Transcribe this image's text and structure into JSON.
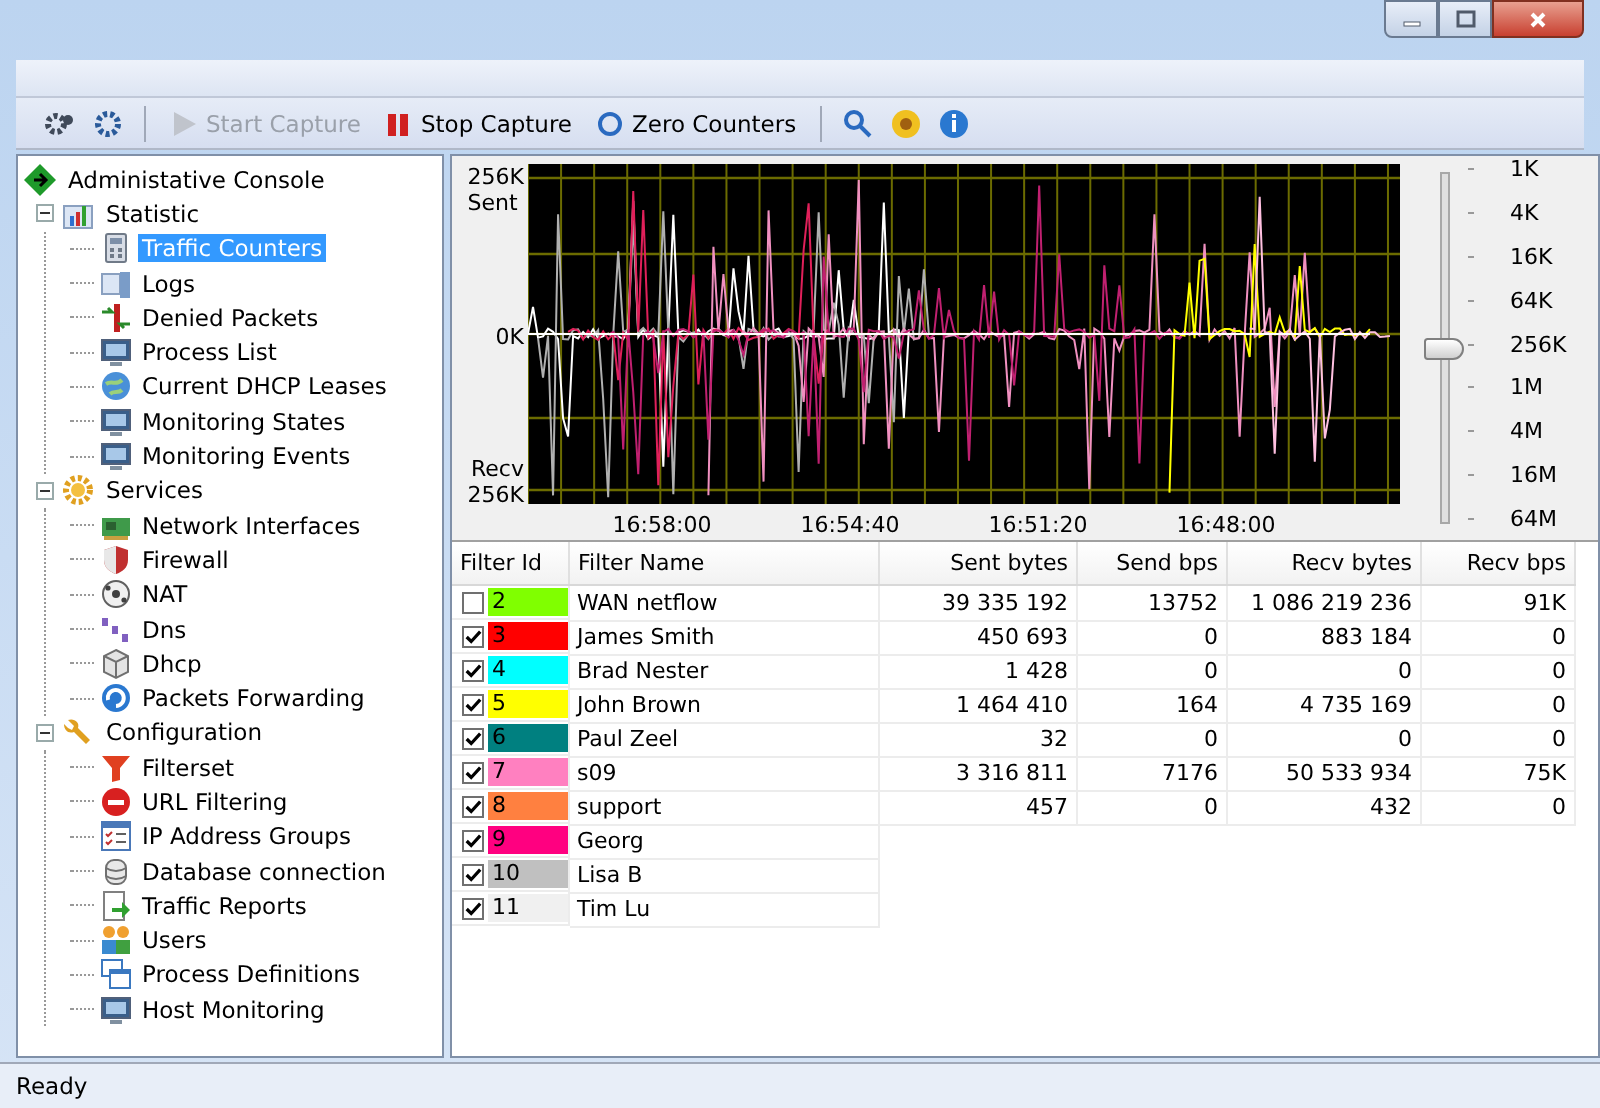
{
  "toolbar": {
    "buttons": [
      {
        "label": "Start Capture",
        "disabled": true
      },
      {
        "label": "Stop Capture",
        "disabled": false
      },
      {
        "label": "Zero Counters",
        "disabled": false
      }
    ]
  },
  "tree": {
    "label": "Administative Console",
    "children": [
      {
        "label": "Statistic",
        "expanded": true,
        "children": [
          {
            "label": "Traffic Counters",
            "selected": true
          },
          {
            "label": "Logs",
            "selected": false
          },
          {
            "label": "Denied Packets",
            "selected": false
          },
          {
            "label": "Process List",
            "selected": false
          },
          {
            "label": "Current DHCP Leases",
            "selected": false
          },
          {
            "label": "Monitoring States",
            "selected": false
          },
          {
            "label": "Monitoring Events",
            "selected": false
          }
        ]
      },
      {
        "label": "Services",
        "expanded": true,
        "children": [
          {
            "label": "Network Interfaces",
            "selected": false
          },
          {
            "label": "Firewall",
            "selected": false
          },
          {
            "label": "NAT",
            "selected": false
          },
          {
            "label": "Dns",
            "selected": false
          },
          {
            "label": "Dhcp",
            "selected": false
          },
          {
            "label": "Packets Forwarding",
            "selected": false
          }
        ]
      },
      {
        "label": "Configuration",
        "expanded": true,
        "children": [
          {
            "label": "Filterset",
            "selected": false
          },
          {
            "label": "URL Filtering",
            "selected": false
          },
          {
            "label": "IP Address Groups",
            "selected": false
          },
          {
            "label": "Database connection",
            "selected": false
          },
          {
            "label": "Traffic Reports",
            "selected": false
          },
          {
            "label": "Users",
            "selected": false
          },
          {
            "label": "Process Definitions",
            "selected": false
          },
          {
            "label": "Host Monitoring",
            "selected": false
          }
        ]
      }
    ]
  },
  "graph": {
    "sent_value": "256K",
    "sent_caption": "Sent",
    "zero_value": "0K",
    "recv_caption": "Recv",
    "recv_value": "256K",
    "time_labels": [
      "16:58:00",
      "16:54:40",
      "16:51:20",
      "16:48:00"
    ]
  },
  "zoom_slider": {
    "level": 0.5,
    "scale_labels": [
      "1K",
      "4K",
      "16K",
      "64K",
      "256K",
      "1M",
      "4M",
      "16M",
      "64M"
    ]
  },
  "table": {
    "columns": [
      "Filter Id",
      "Filter Name",
      "Sent bytes",
      "Send bps",
      "Recv bytes",
      "Recv bps"
    ],
    "rows": [
      {
        "checked": false,
        "color": "#80ff00",
        "id": "2",
        "name": "WAN netflow",
        "sent": "39 335 192",
        "send_bps": "13752",
        "recv": "1 086 219 236",
        "recv_bps": "91K"
      },
      {
        "checked": true,
        "color": "#ff0000",
        "id": "3",
        "name": "James Smith",
        "sent": "450 693",
        "send_bps": "0",
        "recv": "883 184",
        "recv_bps": "0"
      },
      {
        "checked": true,
        "color": "#00ffff",
        "id": "4",
        "name": "Brad Nester",
        "sent": "1 428",
        "send_bps": "0",
        "recv": "0",
        "recv_bps": "0"
      },
      {
        "checked": true,
        "color": "#ffff00",
        "id": "5",
        "name": "John Brown",
        "sent": "1 464 410",
        "send_bps": "164",
        "recv": "4 735 169",
        "recv_bps": "0"
      },
      {
        "checked": true,
        "color": "#008080",
        "id": "6",
        "name": "Paul Zeel",
        "sent": "32",
        "send_bps": "0",
        "recv": "0",
        "recv_bps": "0"
      },
      {
        "checked": true,
        "color": "#ff80c0",
        "id": "7",
        "name": "s09",
        "sent": "3 316 811",
        "send_bps": "7176",
        "recv": "50 533 934",
        "recv_bps": "75K"
      },
      {
        "checked": true,
        "color": "#ff8040",
        "id": "8",
        "name": "support",
        "sent": "457",
        "send_bps": "0",
        "recv": "432",
        "recv_bps": "0"
      },
      {
        "checked": true,
        "color": "#ff0080",
        "id": "9",
        "name": "Georg"
      },
      {
        "checked": true,
        "color": "#c0c0c0",
        "id": "10",
        "name": "Lisa B"
      },
      {
        "checked": true,
        "color": "#f0f0f0",
        "id": "11",
        "name": "Tim Lu"
      }
    ]
  },
  "status_bar": "Ready"
}
